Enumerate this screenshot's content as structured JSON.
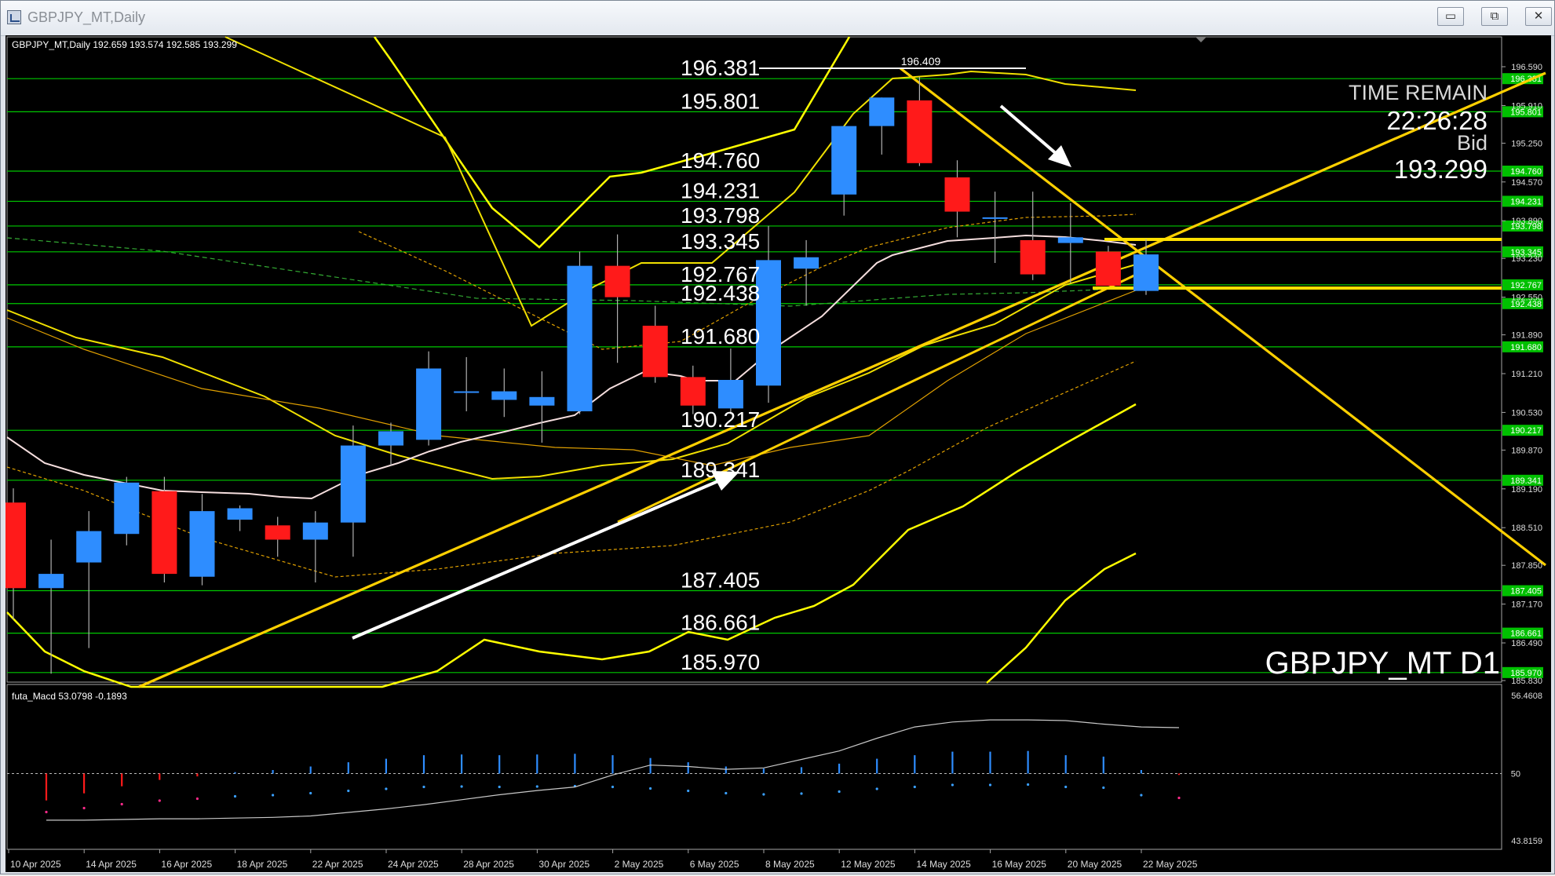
{
  "window": {
    "title": "GBPJPY_MT,Daily",
    "buttons": {
      "minimize": "▭",
      "restore": "⧉",
      "close": "✕"
    }
  },
  "chart_header": "GBPJPY_MT,Daily  192.659 193.574 192.585 193.299",
  "overlay": {
    "time_remain_label": "TIME REMAIN",
    "time_remain_value": "22:26:28",
    "bid_label": "Bid",
    "bid_value": "193.299",
    "symbol_label": "GBPJPY_MT D1"
  },
  "high_marker": "196.409",
  "level_labels": [
    "196.381",
    "195.801",
    "194.760",
    "194.231",
    "193.798",
    "193.345",
    "192.767",
    "192.438",
    "191.680",
    "190.217",
    "189.341",
    "187.405",
    "186.661",
    "185.970"
  ],
  "price_axis_ticks": [
    "196.590",
    "195.910",
    "195.250",
    "194.570",
    "193.890",
    "193.230",
    "192.550",
    "191.890",
    "191.210",
    "190.530",
    "189.870",
    "189.190",
    "188.510",
    "187.850",
    "187.170",
    "186.490",
    "185.830"
  ],
  "macd": {
    "label": "futa_Macd 53.0798  -0.1893",
    "axis_top": "56.4608",
    "axis_mid": "50",
    "axis_bottom": "43.8159"
  },
  "date_labels": [
    "10 Apr 2025",
    "14 Apr 2025",
    "16 Apr 2025",
    "18 Apr 2025",
    "22 Apr 2025",
    "24 Apr 2025",
    "28 Apr 2025",
    "30 Apr 2025",
    "2 May 2025",
    "6 May 2025",
    "8 May 2025",
    "12 May 2025",
    "14 May 2025",
    "16 May 2025",
    "20 May 2025",
    "22 May 2025"
  ],
  "chart_data": {
    "type": "candlestick",
    "symbol": "GBPJPY_MT",
    "timeframe": "Daily",
    "ohlc_last": {
      "open": 192.659,
      "high": 193.574,
      "low": 192.585,
      "close": 193.299
    },
    "y_range": [
      185.83,
      196.59
    ],
    "dates": [
      "10 Apr 2025",
      "11 Apr 2025",
      "14 Apr 2025",
      "15 Apr 2025",
      "16 Apr 2025",
      "17 Apr 2025",
      "18 Apr 2025",
      "21 Apr 2025",
      "22 Apr 2025",
      "23 Apr 2025",
      "24 Apr 2025",
      "25 Apr 2025",
      "28 Apr 2025",
      "29 Apr 2025",
      "30 Apr 2025",
      "1 May 2025",
      "2 May 2025",
      "5 May 2025",
      "6 May 2025",
      "7 May 2025",
      "8 May 2025",
      "9 May 2025",
      "12 May 2025",
      "13 May 2025",
      "14 May 2025",
      "15 May 2025",
      "16 May 2025",
      "19 May 2025",
      "20 May 2025",
      "21 May 2025",
      "22 May 2025"
    ],
    "candles": [
      {
        "o": 188.95,
        "h": 189.2,
        "l": 186.9,
        "c": 187.45
      },
      {
        "o": 187.45,
        "h": 188.3,
        "l": 185.95,
        "c": 187.7
      },
      {
        "o": 187.9,
        "h": 188.8,
        "l": 186.4,
        "c": 188.45
      },
      {
        "o": 188.4,
        "h": 189.4,
        "l": 188.2,
        "c": 189.3
      },
      {
        "o": 189.15,
        "h": 189.4,
        "l": 187.55,
        "c": 187.7
      },
      {
        "o": 187.65,
        "h": 189.1,
        "l": 187.5,
        "c": 188.8
      },
      {
        "o": 188.65,
        "h": 188.9,
        "l": 188.45,
        "c": 188.85
      },
      {
        "o": 188.55,
        "h": 188.7,
        "l": 188.0,
        "c": 188.3
      },
      {
        "o": 188.3,
        "h": 188.8,
        "l": 187.55,
        "c": 188.6
      },
      {
        "o": 188.6,
        "h": 190.3,
        "l": 188.0,
        "c": 189.95
      },
      {
        "o": 189.95,
        "h": 190.35,
        "l": 189.6,
        "c": 190.2
      },
      {
        "o": 190.05,
        "h": 191.6,
        "l": 189.95,
        "c": 191.3
      },
      {
        "o": 190.9,
        "h": 191.5,
        "l": 190.55,
        "c": 190.9
      },
      {
        "o": 190.75,
        "h": 191.3,
        "l": 190.45,
        "c": 190.9
      },
      {
        "o": 190.65,
        "h": 191.25,
        "l": 190.0,
        "c": 190.8
      },
      {
        "o": 190.55,
        "h": 193.35,
        "l": 190.5,
        "c": 193.1
      },
      {
        "o": 193.1,
        "h": 193.65,
        "l": 191.4,
        "c": 192.55
      },
      {
        "o": 192.05,
        "h": 192.4,
        "l": 191.05,
        "c": 191.15
      },
      {
        "o": 191.15,
        "h": 191.35,
        "l": 190.5,
        "c": 190.65
      },
      {
        "o": 190.6,
        "h": 191.65,
        "l": 190.5,
        "c": 191.1
      },
      {
        "o": 191.0,
        "h": 193.8,
        "l": 190.7,
        "c": 193.2
      },
      {
        "o": 193.05,
        "h": 193.55,
        "l": 192.4,
        "c": 193.25
      },
      {
        "o": 194.35,
        "h": 195.3,
        "l": 193.98,
        "c": 195.55
      },
      {
        "o": 195.55,
        "h": 196.05,
        "l": 195.05,
        "c": 196.05
      },
      {
        "o": 196.0,
        "h": 196.41,
        "l": 194.85,
        "c": 194.9
      },
      {
        "o": 194.65,
        "h": 194.95,
        "l": 193.6,
        "c": 194.05
      },
      {
        "o": 193.95,
        "h": 194.4,
        "l": 193.15,
        "c": 193.95
      },
      {
        "o": 193.55,
        "h": 194.4,
        "l": 192.85,
        "c": 192.95
      },
      {
        "o": 193.5,
        "h": 194.2,
        "l": 192.8,
        "c": 193.6
      },
      {
        "o": 193.35,
        "h": 193.45,
        "l": 192.75,
        "c": 192.75
      },
      {
        "o": 192.66,
        "h": 193.57,
        "l": 192.59,
        "c": 193.3
      }
    ],
    "horizontal_levels": [
      196.381,
      195.801,
      194.76,
      194.231,
      193.798,
      193.345,
      192.767,
      192.438,
      191.68,
      190.217,
      189.341,
      187.405,
      186.661,
      185.97
    ],
    "macd_values": [
      -3.8,
      -2.8,
      -1.8,
      -0.9,
      -0.4,
      0.2,
      0.5,
      1.0,
      1.6,
      2.1,
      2.6,
      2.7,
      2.6,
      2.7,
      2.8,
      2.6,
      2.2,
      1.6,
      1.0,
      0.7,
      0.9,
      1.4,
      2.1,
      2.6,
      3.1,
      3.1,
      3.2,
      2.6,
      2.4,
      0.5,
      -0.2
    ],
    "macd_signal": [
      -6.6,
      -6.6,
      -6.5,
      -6.4,
      -6.4,
      -6.3,
      -6.2,
      -6.0,
      -5.5,
      -5.0,
      -4.4,
      -3.7,
      -3.0,
      -2.4,
      -1.9,
      -0.2,
      1.2,
      1.0,
      0.6,
      0.8,
      2.0,
      3.2,
      5.0,
      6.6,
      7.3,
      7.6,
      7.6,
      7.5,
      7.0,
      6.6,
      6.5
    ]
  }
}
